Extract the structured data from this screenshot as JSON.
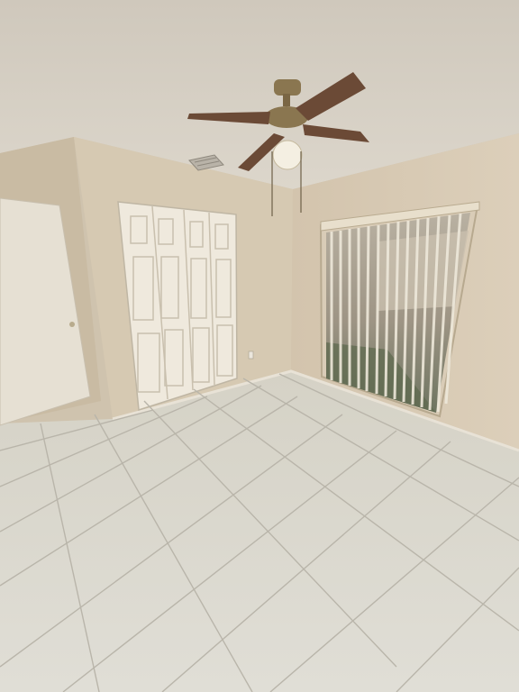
{
  "scene": {
    "kind": "photograph",
    "subject": "empty bedroom",
    "objects": [
      "ceiling-fan",
      "ceiling-vent",
      "bifold-closet-doors",
      "interior-door",
      "sliding-glass-door",
      "vertical-blinds",
      "tile-floor",
      "baseboard",
      "wall-outlet"
    ]
  },
  "colors": {
    "ceiling": "#d6d1c6",
    "left_wall": "#cdbfa8",
    "back_wall": "#d8cbb5",
    "right_wall": "#d6c7b0",
    "floor": "#d9d7cd",
    "grout": "#b9b5aa",
    "door": "#e6e0d3",
    "fan_blade": "#6b4a36",
    "fan_metal": "#8a7650"
  }
}
